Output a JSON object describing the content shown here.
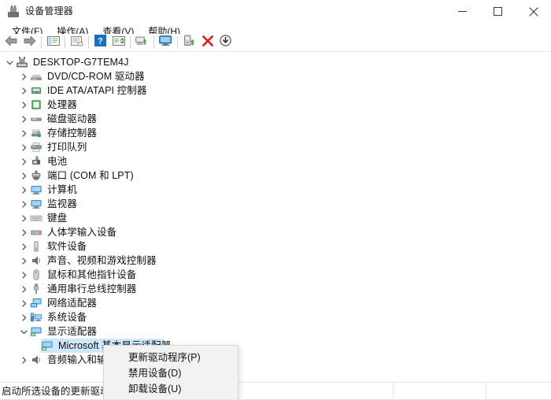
{
  "window": {
    "title": "设备管理器",
    "icon": "device-manager-icon",
    "controls": {
      "minimize": "最小化",
      "maximize": "最大化",
      "close": "关闭"
    }
  },
  "menubar": {
    "items": [
      {
        "label": "文件(F)",
        "name": "menu-file"
      },
      {
        "label": "操作(A)",
        "name": "menu-action"
      },
      {
        "label": "查看(V)",
        "name": "menu-view"
      },
      {
        "label": "帮助(H)",
        "name": "menu-help"
      }
    ]
  },
  "toolbar": {
    "buttons": [
      {
        "icon": "back-arrow-icon",
        "name": "toolbar-back"
      },
      {
        "icon": "forward-arrow-icon",
        "name": "toolbar-forward"
      },
      {
        "icon": "show-hide-console-tree-icon",
        "name": "toolbar-console-tree"
      },
      {
        "icon": "properties-icon",
        "name": "toolbar-properties"
      },
      {
        "icon": "help-icon",
        "name": "toolbar-help"
      },
      {
        "icon": "device-list-icon",
        "name": "toolbar-device-list"
      },
      {
        "icon": "scan-hardware-changes-icon",
        "name": "toolbar-scan-hardware"
      },
      {
        "icon": "monitor-icon",
        "name": "toolbar-monitor"
      },
      {
        "icon": "update-driver-icon",
        "name": "toolbar-update-driver"
      },
      {
        "icon": "uninstall-device-icon",
        "name": "toolbar-uninstall-device"
      },
      {
        "icon": "disable-device-icon",
        "name": "toolbar-disable-device"
      }
    ]
  },
  "tree": {
    "root": {
      "label": "DESKTOP-G7TEM4J",
      "icon": "computer-icon",
      "expanded": true,
      "indent": 0
    },
    "nodes": [
      {
        "label": "DVD/CD-ROM 驱动器",
        "icon": "dvd-drive-icon",
        "expanded": false,
        "indent": 1
      },
      {
        "label": "IDE ATA/ATAPI 控制器",
        "icon": "ide-controller-icon",
        "expanded": false,
        "indent": 1
      },
      {
        "label": "处理器",
        "icon": "processor-icon",
        "expanded": false,
        "indent": 1
      },
      {
        "label": "磁盘驱动器",
        "icon": "disk-drive-icon",
        "expanded": false,
        "indent": 1
      },
      {
        "label": "存储控制器",
        "icon": "storage-controller-icon",
        "expanded": false,
        "indent": 1
      },
      {
        "label": "打印队列",
        "icon": "print-queue-icon",
        "expanded": false,
        "indent": 1
      },
      {
        "label": "电池",
        "icon": "battery-icon",
        "expanded": false,
        "indent": 1
      },
      {
        "label": "端口 (COM 和 LPT)",
        "icon": "port-icon",
        "expanded": false,
        "indent": 1
      },
      {
        "label": "计算机",
        "icon": "computer-node-icon",
        "expanded": false,
        "indent": 1
      },
      {
        "label": "监视器",
        "icon": "monitor-node-icon",
        "expanded": false,
        "indent": 1
      },
      {
        "label": "键盘",
        "icon": "keyboard-icon",
        "expanded": false,
        "indent": 1
      },
      {
        "label": "人体学输入设备",
        "icon": "hid-icon",
        "expanded": false,
        "indent": 1
      },
      {
        "label": "软件设备",
        "icon": "software-device-icon",
        "expanded": false,
        "indent": 1
      },
      {
        "label": "声音、视频和游戏控制器",
        "icon": "sound-controller-icon",
        "expanded": false,
        "indent": 1
      },
      {
        "label": "鼠标和其他指针设备",
        "icon": "mouse-icon",
        "expanded": false,
        "indent": 1
      },
      {
        "label": "通用串行总线控制器",
        "icon": "usb-controller-icon",
        "expanded": false,
        "indent": 1
      },
      {
        "label": "网络适配器",
        "icon": "network-adapter-icon",
        "expanded": false,
        "indent": 1
      },
      {
        "label": "系统设备",
        "icon": "system-device-icon",
        "expanded": false,
        "indent": 1
      },
      {
        "label": "显示适配器",
        "icon": "display-adapter-icon",
        "expanded": true,
        "indent": 1
      },
      {
        "label": "Microsoft 基本显示适配器",
        "icon": "display-adapter-child-icon",
        "expanded": null,
        "indent": 2,
        "selected": true
      },
      {
        "label": "音频输入和输出",
        "icon": "audio-io-icon",
        "expanded": false,
        "indent": 1
      }
    ]
  },
  "context_menu": {
    "items": [
      {
        "label": "更新驱动程序(P)",
        "name": "ctx-update-driver"
      },
      {
        "label": "禁用设备(D)",
        "name": "ctx-disable-device"
      },
      {
        "label": "卸载设备(U)",
        "name": "ctx-uninstall-device"
      }
    ]
  },
  "statusbar": {
    "text": "启动所选设备的更新驱动程序向导。"
  },
  "colors": {
    "selection": "#cde8ff",
    "menu_bg": "#f2f2f2",
    "accent_red": "#e02020",
    "accent_green": "#4caf3f",
    "accent_blue": "#3b8fd6"
  }
}
